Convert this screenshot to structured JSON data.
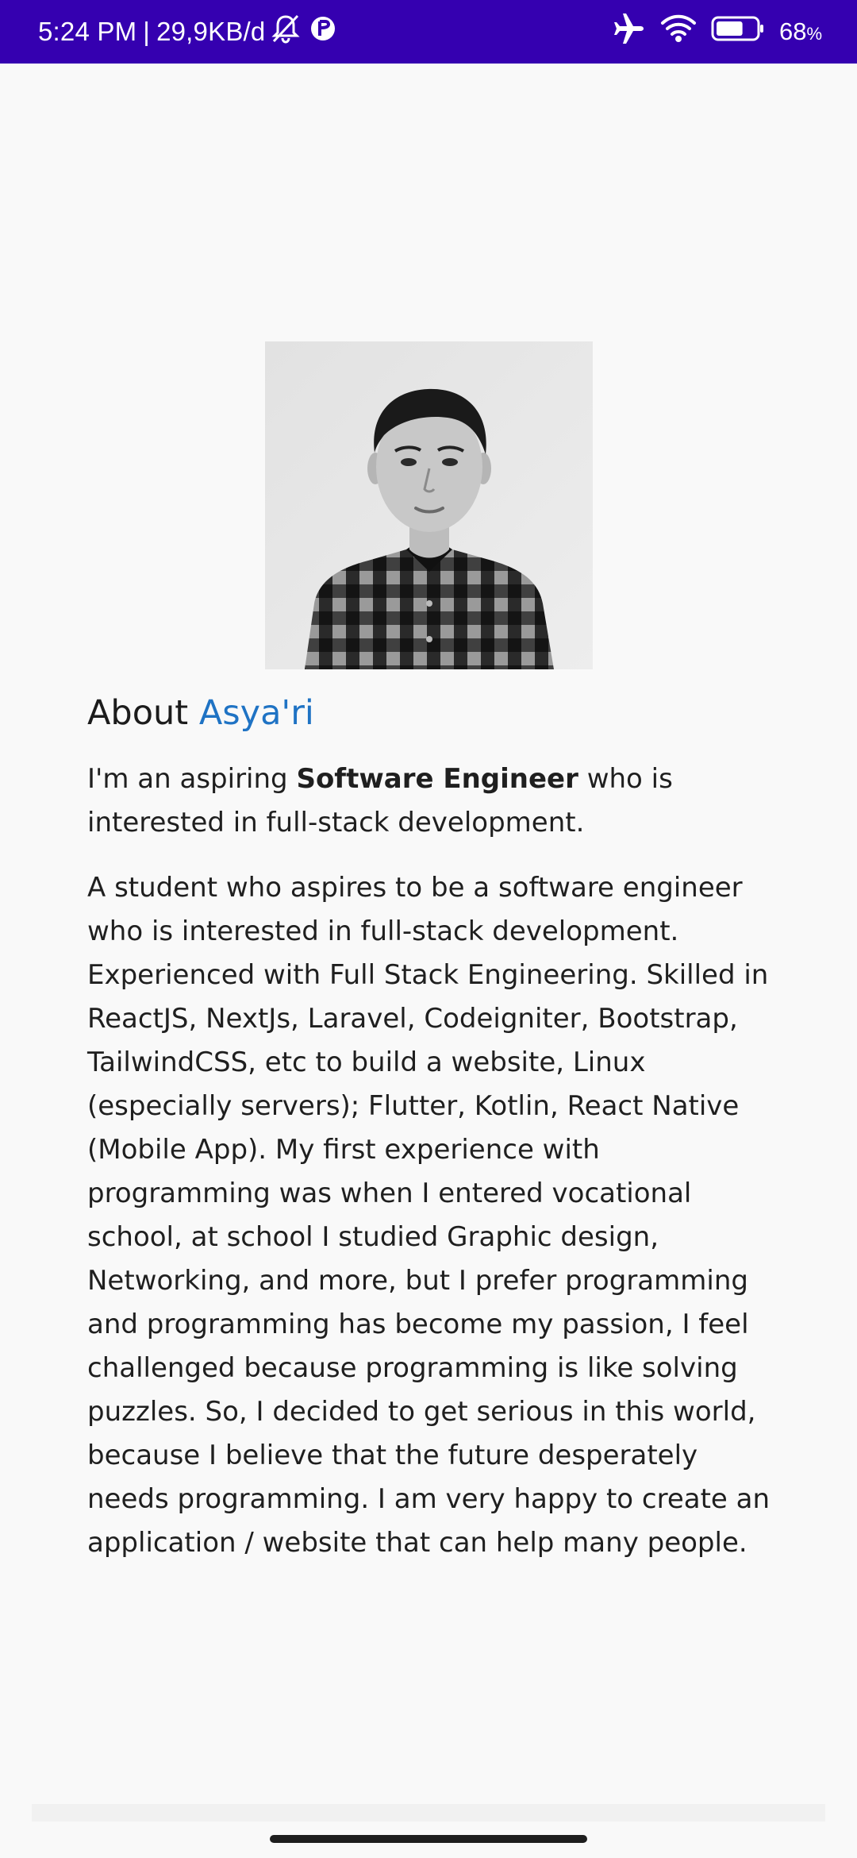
{
  "status_bar": {
    "time": "5:24 PM",
    "separator": "|",
    "network_speed": "29,9KB/d",
    "battery_percent": "68",
    "battery_unit": "%",
    "battery_level": 0.68,
    "icons": [
      "notifications-off-icon",
      "data-saver-icon",
      "airplane-mode-icon",
      "wifi-icon",
      "battery-icon"
    ]
  },
  "about": {
    "heading_prefix": "About",
    "heading_name": "Asya'ri",
    "intro_before": "I'm an aspiring",
    "intro_bold": "Software Engineer",
    "intro_after": "who is interested in full-stack development.",
    "bio": "A student who aspires to be a software engineer who is interested in full-stack development. Experienced with Full Stack Engineering. Skilled in ReactJS, NextJs, Laravel, Codeigniter, Bootstrap, TailwindCSS, etc to build a website, Linux (especially servers); Flutter, Kotlin, React Native (Mobile App). My first experience with programming was when I entered vocational school, at school I studied Graphic design, Networking, and more, but I prefer programming and programming has become my passion, I feel challenged because programming is like solving puzzles. So, I decided to get serious in this world, because I believe that the future desperately needs programming. I am very happy to create an application / website that can help many people."
  },
  "colors": {
    "status_bar": "#3500b0",
    "accent_name": "#1f73c4",
    "background": "#f9f9f9",
    "text": "#1c1c1c"
  }
}
